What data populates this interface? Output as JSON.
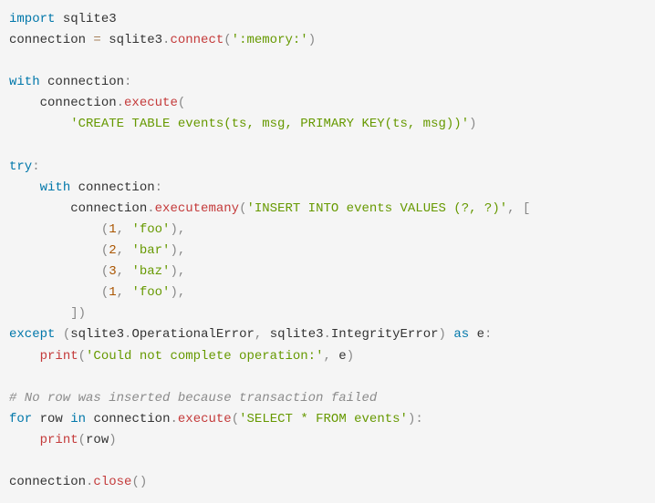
{
  "code": {
    "line1": {
      "import": "import",
      "module": "sqlite3"
    },
    "line2": {
      "var": "connection",
      "eq": " = ",
      "module": "sqlite3",
      "dot": ".",
      "func": "connect",
      "open": "(",
      "string": "':memory:'",
      "close": ")"
    },
    "line4": {
      "with": "with",
      "sp": " ",
      "var": "connection",
      "colon": ":"
    },
    "line5": {
      "indent": "    ",
      "var": "connection",
      "dot": ".",
      "func": "execute",
      "open": "("
    },
    "line6": {
      "indent": "        ",
      "string": "'CREATE TABLE events(ts, msg, PRIMARY KEY(ts, msg))'",
      "close": ")"
    },
    "line8": {
      "try": "try",
      "colon": ":"
    },
    "line9": {
      "indent": "    ",
      "with": "with",
      "sp": " ",
      "var": "connection",
      "colon": ":"
    },
    "line10": {
      "indent": "        ",
      "var": "connection",
      "dot": ".",
      "func": "executemany",
      "open": "(",
      "string": "'INSERT INTO events VALUES (?, ?)'",
      "comma": ",",
      "sp": " ",
      "bracket": "["
    },
    "line11": {
      "indent": "            ",
      "open": "(",
      "num": "1",
      "comma1": ",",
      "sp": " ",
      "string": "'foo'",
      "close": ")",
      "comma2": ","
    },
    "line12": {
      "indent": "            ",
      "open": "(",
      "num": "2",
      "comma1": ",",
      "sp": " ",
      "string": "'bar'",
      "close": ")",
      "comma2": ","
    },
    "line13": {
      "indent": "            ",
      "open": "(",
      "num": "3",
      "comma1": ",",
      "sp": " ",
      "string": "'baz'",
      "close": ")",
      "comma2": ","
    },
    "line14": {
      "indent": "            ",
      "open": "(",
      "num": "1",
      "comma1": ",",
      "sp": " ",
      "string": "'foo'",
      "close": ")",
      "comma2": ","
    },
    "line15": {
      "indent": "        ",
      "bracket": "]",
      "close": ")"
    },
    "line16": {
      "except": "except",
      "sp1": " ",
      "open": "(",
      "mod1": "sqlite3",
      "dot1": ".",
      "err1": "OperationalError",
      "comma": ",",
      "sp2": " ",
      "mod2": "sqlite3",
      "dot2": ".",
      "err2": "IntegrityError",
      "close": ")",
      "sp3": " ",
      "as": "as",
      "sp4": " ",
      "var": "e",
      "colon": ":"
    },
    "line17": {
      "indent": "    ",
      "func": "print",
      "open": "(",
      "string": "'Could not complete operation:'",
      "comma": ",",
      "sp": " ",
      "var": "e",
      "close": ")"
    },
    "line19": {
      "comment": "# No row was inserted because transaction failed"
    },
    "line20": {
      "for": "for",
      "sp1": " ",
      "var1": "row",
      "sp2": " ",
      "in": "in",
      "sp3": " ",
      "var2": "connection",
      "dot": ".",
      "func": "execute",
      "open": "(",
      "string": "'SELECT * FROM events'",
      "close": ")",
      "colon": ":"
    },
    "line21": {
      "indent": "    ",
      "func": "print",
      "open": "(",
      "var": "row",
      "close": ")"
    },
    "line23": {
      "var": "connection",
      "dot": ".",
      "func": "close",
      "open": "(",
      "close": ")"
    }
  }
}
